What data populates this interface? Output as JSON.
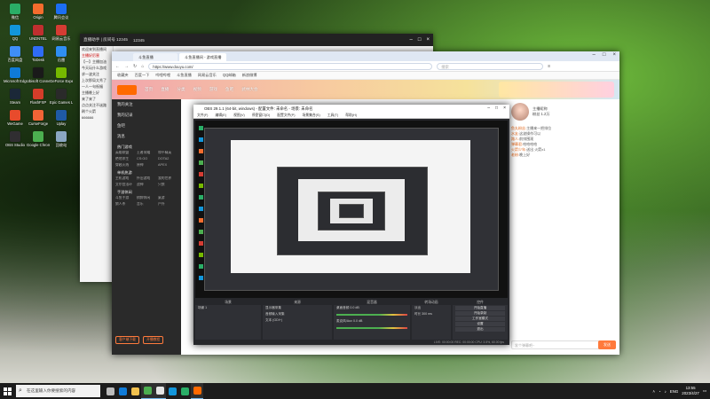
{
  "desktop": {
    "icons": [
      {
        "label": "微信",
        "color": "#2aae67"
      },
      {
        "label": "QQ",
        "color": "#1296db"
      },
      {
        "label": "百度网盘",
        "color": "#3f8ef7"
      },
      {
        "label": "Microsoft Edge",
        "color": "#0f7bd8"
      },
      {
        "label": "Steam",
        "color": "#1b2838"
      },
      {
        "label": "WeGame",
        "color": "#e84b2c"
      },
      {
        "label": "OBS Studio",
        "color": "#302e31"
      },
      {
        "label": "Origin",
        "color": "#f56c2d"
      },
      {
        "label": "UNDNTEL",
        "color": "#c02f2f"
      },
      {
        "label": "ToDesk",
        "color": "#2f6cf6"
      },
      {
        "label": "Ubisoft Connect",
        "color": "#1a1a1a"
      },
      {
        "label": "FlashFXP",
        "color": "#d43d2a"
      },
      {
        "label": "CurseForge",
        "color": "#f16436"
      },
      {
        "label": "Google Chrome",
        "color": "#4caf50"
      },
      {
        "label": "腾讯会议",
        "color": "#1c6ef2"
      },
      {
        "label": "网易云音乐",
        "color": "#d43c33"
      },
      {
        "label": "迅雷",
        "color": "#2f8ef2"
      },
      {
        "label": "GeForce Experience",
        "color": "#76b900"
      },
      {
        "label": "Epic Games Launcher",
        "color": "#2a2a2a"
      },
      {
        "label": "Uplay",
        "color": "#1f5aa6"
      },
      {
        "label": "回收站",
        "color": "#8aa7c2"
      }
    ]
  },
  "chat_window": {
    "title": "直播助手  |  房间号 12345",
    "user": "12345",
    "lines": [
      {
        "text": "欢迎来到直播间",
        "red": false
      },
      {
        "text": "主播好厉害",
        "red": true
      },
      {
        "text": "【一】主播加油",
        "red": false
      },
      {
        "text": "今天玩什么游戏",
        "red": false
      },
      {
        "text": "求一波关注",
        "red": false
      },
      {
        "text": "上次那局太秀了",
        "red": false
      },
      {
        "text": "一人一句祝福",
        "red": false
      },
      {
        "text": "主播晚上好",
        "red": false
      },
      {
        "text": "来了来了",
        "red": false
      },
      {
        "text": "点点关注不迷路",
        "red": false
      },
      {
        "text": "刷个火箭",
        "red": false
      },
      {
        "text": "666666",
        "red": false
      }
    ]
  },
  "browser": {
    "tabs": [
      {
        "label": "斗鱼直播",
        "active": false
      },
      {
        "label": "斗鱼直播间 - 游戏直播",
        "active": true
      }
    ],
    "url": "https://www.douyu.com/",
    "search_placeholder": "搜索",
    "bookmarks": [
      "收藏夹",
      "百度一下",
      "哔哩哔哩",
      "斗鱼直播",
      "网易云音乐",
      "QQ邮箱",
      "新浪微博"
    ],
    "nav": [
      "首页",
      "直播",
      "分类",
      "视频",
      "游戏",
      "鱼吧",
      "武林大会"
    ],
    "side_menu": [
      "我的关注",
      "我的记录",
      "鱼吧",
      "消息"
    ],
    "side_sections": [
      {
        "title": "热门游戏",
        "items": [
          "英雄联盟",
          "王者荣耀",
          "和平精英",
          "绝地求生",
          "CS:GO",
          "DOTA2",
          "穿越火线",
          "原神",
          "APEX"
        ]
      },
      {
        "title": "单机热游",
        "items": [
          "主机游戏",
          "怀旧游戏",
          "我的世界",
          "艾尔登法环",
          "战神",
          "只狼"
        ]
      },
      {
        "title": "手游休闲",
        "items": [
          "斗鱼手游",
          "棋牌休闲",
          "桌游",
          "狼人杀",
          "音乐",
          "户外"
        ]
      }
    ],
    "side_buttons": [
      "客户端下载",
      "开播教程"
    ],
    "streamer": {
      "name": "主播昵称",
      "fans": "粉丝 1.2万"
    },
    "chat_msgs": [
      {
        "user": "鱼丸粉丝:",
        "text": "主播来一把排位"
      },
      {
        "user": "水友:",
        "text": "这波操作可以"
      },
      {
        "user": "路人:",
        "text": "前排围观"
      },
      {
        "user": "弹幕君:",
        "text": "哈哈哈哈"
      },
      {
        "user": "火箭少年:",
        "text": "送出 火箭x1"
      },
      {
        "user": "老粉:",
        "text": "晚上好"
      }
    ],
    "chat_input_placeholder": "发个弹幕吧~",
    "send_label": "发送"
  },
  "obs": {
    "title": "OBS 29.1.1 (64-bit, windows) - 配置文件: 未命名 - 场景: 未命名",
    "menu": [
      "文件(F)",
      "编辑(E)",
      "视图(V)",
      "停靠窗口(D)",
      "配置文件(P)",
      "场景集合(S)",
      "工具(T)",
      "帮助(H)"
    ],
    "docks": [
      {
        "title": "场景",
        "rows": [
          "场景 1"
        ]
      },
      {
        "title": "来源",
        "rows": [
          "显示器采集",
          "音频输入采集",
          "文本 (GDI+)"
        ]
      },
      {
        "title": "混音器",
        "rows": [
          "桌面音频  0.0 dB",
          "麦克风/Aux  0.0 dB"
        ]
      },
      {
        "title": "转场动画",
        "rows": [
          "淡出",
          "时长 300 ms"
        ]
      },
      {
        "title": "控件",
        "rows": [
          "开始直播",
          "开始录制",
          "工作室模式",
          "设置",
          "退出"
        ]
      }
    ],
    "status": "LIVE: 00:00:00  REC: 00:00:00  CPU: 3.5%, 60.00 fps"
  },
  "taskbar": {
    "search_placeholder": "在这里输入你要搜索的内容",
    "apps": [
      {
        "name": "task-view",
        "color": "#bbbbbb",
        "active": false
      },
      {
        "name": "edge",
        "color": "#0f7bd8",
        "active": false
      },
      {
        "name": "explorer",
        "color": "#f2c14e",
        "active": false
      },
      {
        "name": "chrome",
        "color": "#4caf50",
        "active": true
      },
      {
        "name": "obs",
        "color": "#e5e5e5",
        "active": true
      },
      {
        "name": "qq",
        "color": "#1296db",
        "active": false
      },
      {
        "name": "wechat",
        "color": "#2aae67",
        "active": false
      },
      {
        "name": "douyu",
        "color": "#ff6a00",
        "active": true
      }
    ],
    "lang": "ENG",
    "time": "13:55",
    "date": "2023/4/27"
  }
}
